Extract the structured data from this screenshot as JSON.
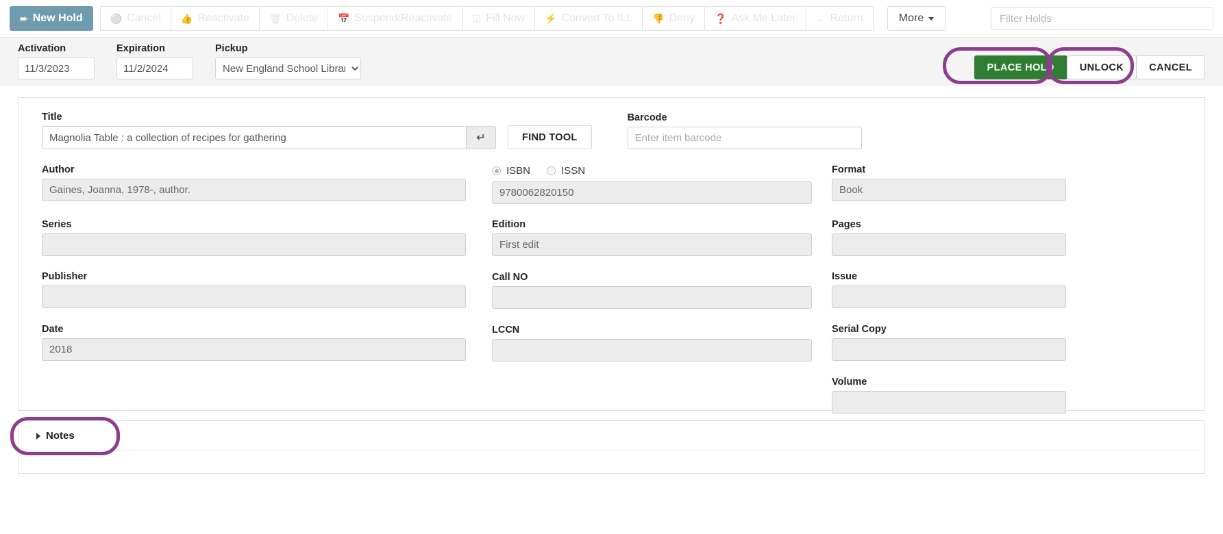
{
  "toolbar": {
    "buttons": [
      {
        "label": "New Hold",
        "icon": "sign-in-icon",
        "glyph": "➜",
        "state": "primary"
      },
      {
        "label": "Cancel",
        "icon": "minus-circle-icon",
        "glyph": "⊖",
        "state": "disabled"
      },
      {
        "label": "Reactivate",
        "icon": "thumbs-up-icon",
        "glyph": "ὄD",
        "state": "disabled"
      },
      {
        "label": "Delete",
        "icon": "trash-icon",
        "glyph": "Ὕ1",
        "state": "disabled"
      },
      {
        "label": "Suspend/Reactivate",
        "icon": "calendar-icon",
        "glyph": "Ὄ5",
        "state": "disabled"
      },
      {
        "label": "Fill Now",
        "icon": "check-square-icon",
        "glyph": "☑",
        "state": "disabled"
      },
      {
        "label": "Convert To ILL",
        "icon": "bolt-icon",
        "glyph": "⚡",
        "state": "disabled"
      },
      {
        "label": "Deny",
        "icon": "thumbs-down-icon",
        "glyph": "ὄE",
        "state": "disabled"
      },
      {
        "label": "Ask Me Later",
        "icon": "question-circle-icon",
        "glyph": "❓",
        "state": "disabled"
      },
      {
        "label": "Return",
        "icon": "arrow-left-icon",
        "glyph": "←",
        "state": "disabled"
      }
    ],
    "more_label": "More",
    "filter_placeholder": "Filter Holds",
    "filter_value": ""
  },
  "subbar": {
    "activation": {
      "label": "Activation",
      "value": "11/3/2023"
    },
    "expiration": {
      "label": "Expiration",
      "value": "11/2/2024"
    },
    "pickup": {
      "label": "Pickup",
      "value": "New England School Library",
      "options": [
        "New England School Library"
      ]
    },
    "actions": {
      "place_hold": "PLACE HOLD",
      "unlock": "UNLOCK",
      "cancel": "CANCEL"
    }
  },
  "form": {
    "title": {
      "label": "Title",
      "value": "Magnolia Table : a collection of recipes for gathering"
    },
    "find_tool": "FIND TOOL",
    "barcode": {
      "label": "Barcode",
      "value": "",
      "placeholder": "Enter item barcode"
    },
    "author": {
      "label": "Author",
      "value": "Gaines, Joanna, 1978-, author."
    },
    "identifier": {
      "isbn_label": "ISBN",
      "issn_label": "ISSN",
      "selected": "ISBN",
      "value": "9780062820150"
    },
    "format": {
      "label": "Format",
      "value": "Book"
    },
    "series": {
      "label": "Series",
      "value": ""
    },
    "edition": {
      "label": "Edition",
      "value": "First edit"
    },
    "pages": {
      "label": "Pages",
      "value": ""
    },
    "publisher": {
      "label": "Publisher",
      "value": ""
    },
    "call_no": {
      "label": "Call NO",
      "value": ""
    },
    "issue": {
      "label": "Issue",
      "value": ""
    },
    "date": {
      "label": "Date",
      "value": "2018"
    },
    "lccn": {
      "label": "LCCN",
      "value": ""
    },
    "serial_copy": {
      "label": "Serial Copy",
      "value": ""
    },
    "volume": {
      "label": "Volume",
      "value": ""
    }
  },
  "notes": {
    "label": "Notes"
  },
  "colors": {
    "primary_button": "#6e9cae",
    "place_hold_green": "#2e7d32",
    "annotation_purple": "#8e3d8e",
    "field_gray": "#ececec"
  }
}
